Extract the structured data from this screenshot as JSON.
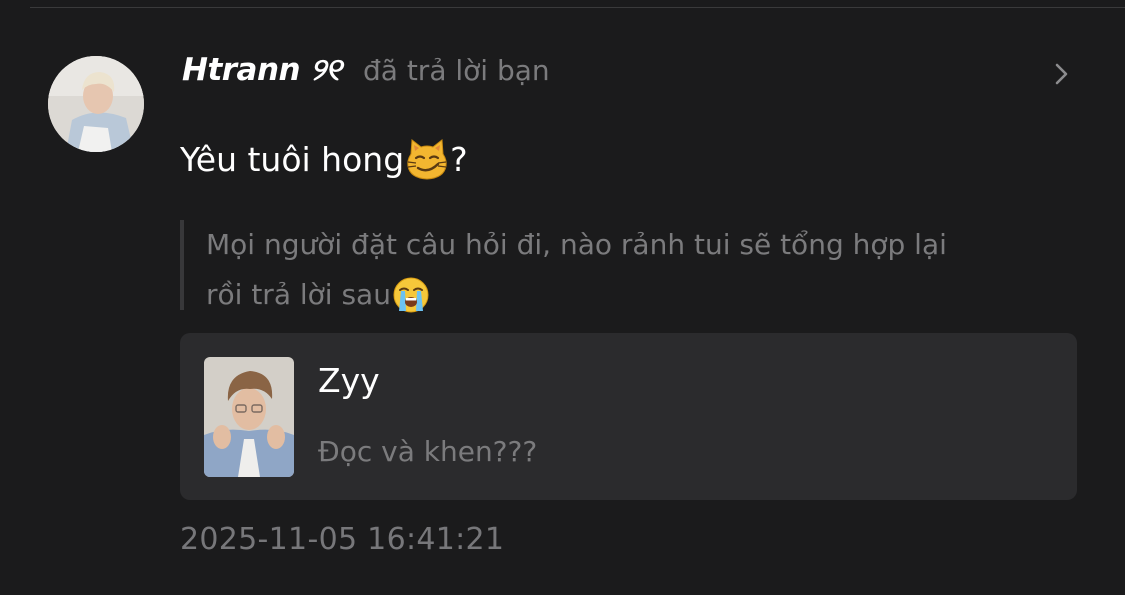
{
  "notification": {
    "username": "Htrann ୨୧",
    "action": "đã trả lời bạn",
    "message": "Yêu tuôi hong",
    "message_suffix": "?",
    "message_emoji": "smirk-cat-emoji",
    "quote": {
      "line1": "Mọi người đặt câu hỏi đi, nào rảnh tui sẽ tổng hợp lại",
      "line2": "rồi trả lời sau",
      "emoji": "loudly-crying-emoji"
    },
    "post": {
      "author": "Zyy",
      "text": "Đọc và khen???"
    },
    "timestamp": "2025-11-05 16:41:21"
  },
  "icons": {
    "chevron": "chevron-right-icon"
  },
  "colors": {
    "background": "#1b1b1c",
    "card": "#2b2b2d",
    "muted_text": "#7b7b7d",
    "primary_text": "#ffffff"
  }
}
